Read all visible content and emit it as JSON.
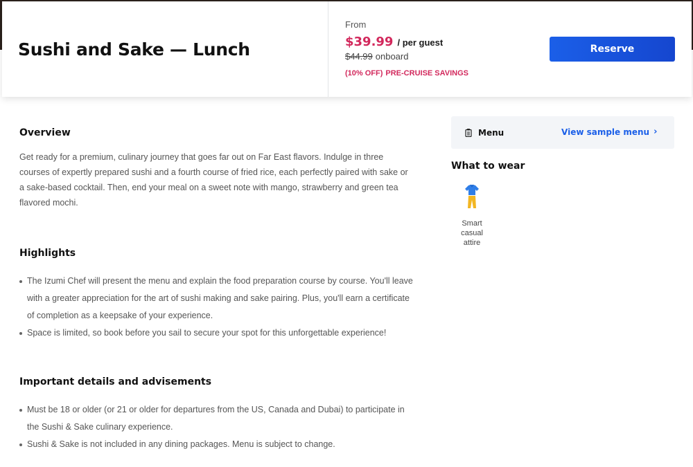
{
  "header": {
    "title": "Sushi and Sake — Lunch",
    "from_label": "From",
    "price": "$39.99",
    "per_guest": "/ per guest",
    "old_price": "$44.99",
    "onboard": "onboard",
    "discount": "(10% OFF)",
    "savings": "PRE-CRUISE SAVINGS",
    "reserve_label": "Reserve"
  },
  "overview": {
    "title": "Overview",
    "text": "Get ready for a premium, culinary journey that goes far out on Far East flavors. Indulge in three courses of expertly prepared sushi and a fourth course of fried rice, each perfectly paired with sake or a sake-based cocktail. Then, end your meal on a sweet note with mango, strawberry and green tea flavored mochi."
  },
  "highlights": {
    "title": "Highlights",
    "items": [
      "The Izumi Chef will present the menu and explain the food preparation course by course. You'll leave with a greater appreciation for the art of sushi making and sake pairing. Plus, you'll earn a certificate of completion as a keepsake of your experience.",
      "Space is limited, so book before you sail to secure your spot for this unforgettable experience!"
    ]
  },
  "important": {
    "title": "Important details and advisements",
    "items": [
      "Must be 18 or older (or 21 or older for departures from the US, Canada and Dubai) to participate in the Sushi & Sake culinary experience.",
      "Sushi & Sake is not included in any dining packages. Menu is subject to change."
    ]
  },
  "sidebar": {
    "menu_label": "Menu",
    "menu_link": "View sample menu",
    "menu_icon": "menu-card-icon",
    "wear_title": "What to wear",
    "wear_items": [
      {
        "icon": "shirt-pants-icon",
        "label": "Smart casual attire"
      }
    ]
  },
  "colors": {
    "accent_pink": "#d2285c",
    "button_blue": "#1b5fe8",
    "text_dark": "#111111"
  }
}
